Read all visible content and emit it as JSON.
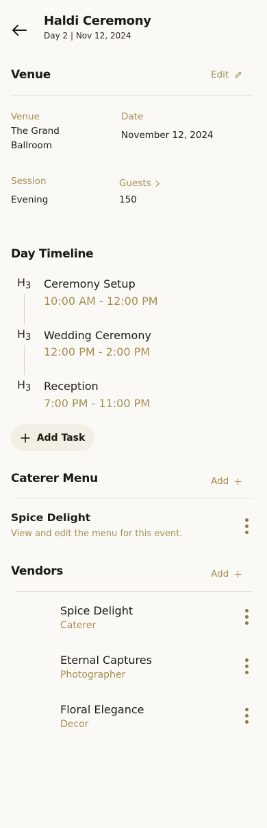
{
  "header": {
    "title": "Haldi Ceremony",
    "subtitle": "Day 2 | Nov 12, 2024"
  },
  "venue_section": {
    "title": "Venue",
    "edit_label": "Edit",
    "venue_label": "Venue",
    "venue_value_line1": "The Grand",
    "venue_value_line2": "Ballroom",
    "date_label": "Date",
    "date_value": "November 12, 2024",
    "session_label": "Session",
    "session_value": "Evening",
    "guests_label": "Guests",
    "guests_value": "150"
  },
  "timeline": {
    "title": "Day Timeline",
    "items": [
      {
        "icon": "H3",
        "name": "Ceremony Setup",
        "time": "10:00 AM - 12:00 PM"
      },
      {
        "icon": "H3",
        "name": "Wedding Ceremony",
        "time": "12:00 PM - 2:00 PM"
      },
      {
        "icon": "H3",
        "name": "Reception",
        "time": "7:00 PM - 11:00 PM"
      }
    ],
    "add_task_label": "Add Task"
  },
  "caterer": {
    "title": "Caterer Menu",
    "add_label": "Add",
    "menu_name": "Spice Delight",
    "menu_desc": "View and edit the menu for this event."
  },
  "vendors": {
    "title": "Vendors",
    "add_label": "Add",
    "items": [
      {
        "name": "Spice Delight",
        "role": "Caterer"
      },
      {
        "name": "Eternal Captures",
        "role": "Photographer"
      },
      {
        "name": "Floral Elegance",
        "role": "Decor"
      }
    ]
  },
  "colors": {
    "background": "#fbf9f5",
    "accent": "#a38f52",
    "pill": "#f3efe4"
  },
  "icons": [
    "arrow-left-icon",
    "pencil-icon",
    "chevron-right-icon",
    "plus-icon",
    "kebab-icon"
  ]
}
